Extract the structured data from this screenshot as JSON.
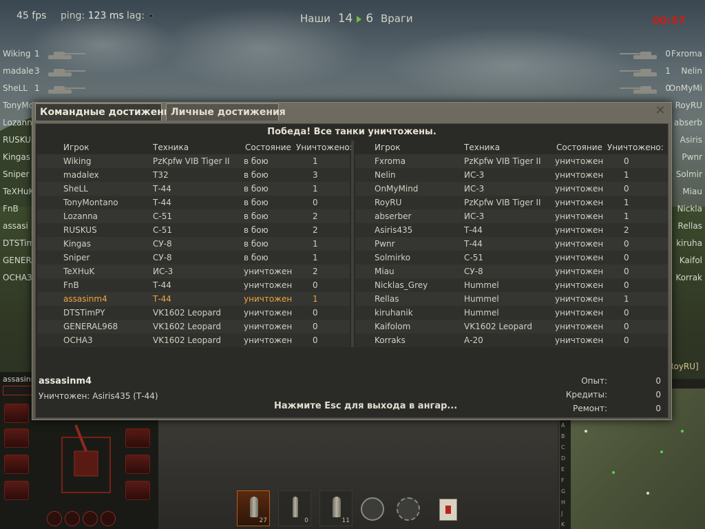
{
  "hud": {
    "fps": "45 fps",
    "ping_label": "ping:",
    "ping_value": "123 ms",
    "lag_label": "lag:",
    "ally_label": "Наши",
    "ally_score": "14",
    "enemy_score": "6",
    "enemy_label": "Враги",
    "timer": "00:57"
  },
  "side_left": [
    {
      "name": "Wiking",
      "frags": "1"
    },
    {
      "name": "madale",
      "frags": "3"
    },
    {
      "name": "SheLL",
      "frags": "1"
    },
    {
      "name": "TonyMo",
      "frags": ""
    },
    {
      "name": "Lozann",
      "frags": ""
    },
    {
      "name": "RUSKUS",
      "frags": ""
    },
    {
      "name": "Kingas",
      "frags": ""
    },
    {
      "name": "Sniper",
      "frags": ""
    },
    {
      "name": "TeXHuK",
      "frags": ""
    },
    {
      "name": "FnB",
      "frags": ""
    },
    {
      "name": "assasi",
      "frags": ""
    },
    {
      "name": "DTSTim",
      "frags": ""
    },
    {
      "name": "GENERA",
      "frags": ""
    },
    {
      "name": "OCHA3",
      "frags": ""
    }
  ],
  "side_right": [
    {
      "name": "Fxroma",
      "frags": "0"
    },
    {
      "name": "Nelin",
      "frags": "1"
    },
    {
      "name": "OnMyMi",
      "frags": "0"
    },
    {
      "name": "RoyRU",
      "frags": ""
    },
    {
      "name": "abserb",
      "frags": ""
    },
    {
      "name": "Asiris",
      "frags": ""
    },
    {
      "name": "Pwnr",
      "frags": ""
    },
    {
      "name": "Solmir",
      "frags": ""
    },
    {
      "name": "Miau",
      "frags": ""
    },
    {
      "name": "Nickla",
      "frags": ""
    },
    {
      "name": "Rellas",
      "frags": ""
    },
    {
      "name": "kiruha",
      "frags": ""
    },
    {
      "name": "Kaifol",
      "frags": ""
    },
    {
      "name": "Korrak",
      "frags": ""
    }
  ],
  "dmg_panel_name": "assasinm4",
  "minimap_letters": [
    "A",
    "B",
    "C",
    "D",
    "E",
    "F",
    "G",
    "H",
    "J",
    "K"
  ],
  "minimap_label": "[RoyRU]",
  "ammo": [
    {
      "count": "27",
      "active": true
    },
    {
      "count": "0",
      "active": false
    },
    {
      "count": "11",
      "active": false
    }
  ],
  "dialog": {
    "tab_team": "Командные достижения",
    "tab_personal": "Личные достижения",
    "close_glyph": "✕",
    "banner": "Победа! Все танки уничтожены.",
    "headers": {
      "player": "Игрок",
      "tank": "Техника",
      "state": "Состояние",
      "kills": "Уничтожено:"
    },
    "ally": [
      {
        "name": "Wiking",
        "tank": "PzKpfw VIB Tiger II",
        "state": "в бою",
        "kills": "1"
      },
      {
        "name": "madalex",
        "tank": "T32",
        "state": "в бою",
        "kills": "3"
      },
      {
        "name": "SheLL",
        "tank": "Т-44",
        "state": "в бою",
        "kills": "1"
      },
      {
        "name": "TonyMontano",
        "tank": "Т-44",
        "state": "в бою",
        "kills": "0"
      },
      {
        "name": "Lozanna",
        "tank": "С-51",
        "state": "в бою",
        "kills": "2"
      },
      {
        "name": "RUSKUS",
        "tank": "С-51",
        "state": "в бою",
        "kills": "2"
      },
      {
        "name": "Kingas",
        "tank": "СУ-8",
        "state": "в бою",
        "kills": "1"
      },
      {
        "name": "Sniper",
        "tank": "СУ-8",
        "state": "в бою",
        "kills": "1"
      },
      {
        "name": "TeXHuK",
        "tank": "ИС-3",
        "state": "уничтожен",
        "kills": "2"
      },
      {
        "name": "FnB",
        "tank": "Т-44",
        "state": "уничтожен",
        "kills": "0"
      },
      {
        "name": "assasinm4",
        "tank": "Т-44",
        "state": "уничтожен",
        "kills": "1",
        "me": true
      },
      {
        "name": "DTSTimPY",
        "tank": "VK1602 Leopard",
        "state": "уничтожен",
        "kills": "0"
      },
      {
        "name": "GENERAL968",
        "tank": "VK1602 Leopard",
        "state": "уничтожен",
        "kills": "0"
      },
      {
        "name": "OCHA3",
        "tank": "VK1602 Leopard",
        "state": "уничтожен",
        "kills": "0"
      }
    ],
    "enemy": [
      {
        "name": "Fxroma",
        "tank": "PzKpfw VIB Tiger II",
        "state": "уничтожен",
        "kills": "0"
      },
      {
        "name": "Nelin",
        "tank": "ИС-3",
        "state": "уничтожен",
        "kills": "1"
      },
      {
        "name": "OnMyMind",
        "tank": "ИС-3",
        "state": "уничтожен",
        "kills": "0"
      },
      {
        "name": "RoyRU",
        "tank": "PzKpfw VIB Tiger II",
        "state": "уничтожен",
        "kills": "1"
      },
      {
        "name": "abserber",
        "tank": "ИС-3",
        "state": "уничтожен",
        "kills": "1"
      },
      {
        "name": "Asiris435",
        "tank": "Т-44",
        "state": "уничтожен",
        "kills": "2"
      },
      {
        "name": "Pwnr",
        "tank": "Т-44",
        "state": "уничтожен",
        "kills": "0"
      },
      {
        "name": "Solmirko",
        "tank": "С-51",
        "state": "уничтожен",
        "kills": "0"
      },
      {
        "name": "Miau",
        "tank": "СУ-8",
        "state": "уничтожен",
        "kills": "0"
      },
      {
        "name": "Nicklas_Grey",
        "tank": "Hummel",
        "state": "уничтожен",
        "kills": "0"
      },
      {
        "name": "Rellas",
        "tank": "Hummel",
        "state": "уничтожен",
        "kills": "1"
      },
      {
        "name": "kiruhanik",
        "tank": "Hummel",
        "state": "уничтожен",
        "kills": "0"
      },
      {
        "name": "Kaifolom",
        "tank": "VK1602 Leopard",
        "state": "уничтожен",
        "kills": "0"
      },
      {
        "name": "Korraks",
        "tank": "А-20",
        "state": "уничтожен",
        "kills": "0"
      }
    ],
    "result": {
      "player": "assasinm4",
      "killed_by": "Уничтожен: Asiris435 (Т-44)",
      "esc_message": "Нажмите Esc для выхода в ангар...",
      "exp_label": "Опыт:",
      "exp_value": "0",
      "credits_label": "Кредиты:",
      "credits_value": "0",
      "repair_label": "Ремонт:",
      "repair_value": "0"
    }
  },
  "colors": {
    "self_highlight": "#f0a443",
    "timer_red": "#c81f17",
    "score_arrow_green": "#6fbf3a"
  }
}
